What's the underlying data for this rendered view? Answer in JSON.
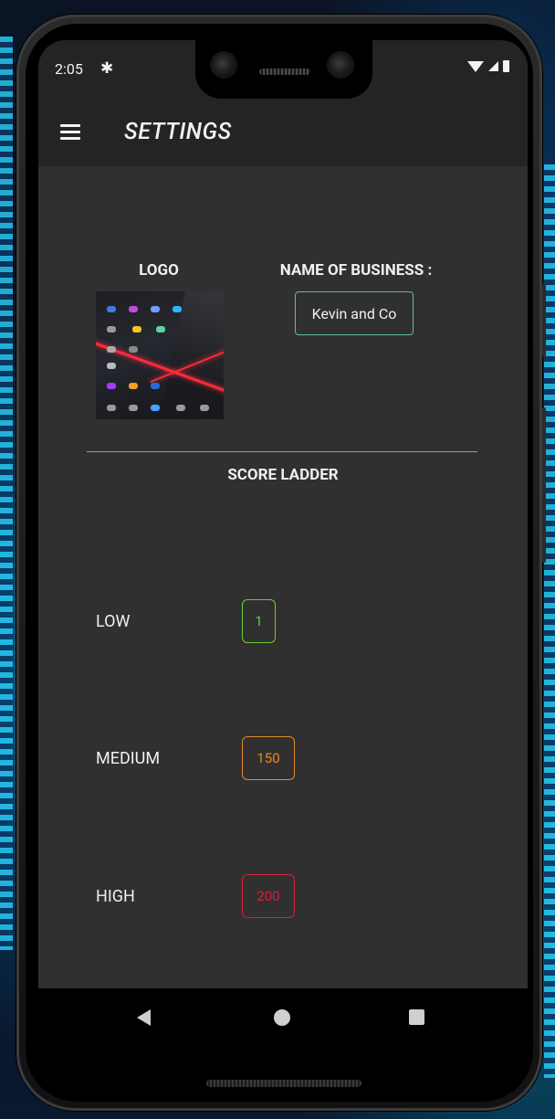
{
  "status_bar": {
    "time": "2:05",
    "settings_icon": "gear-icon",
    "wifi_icon": "wifi-icon",
    "signal_icon": "cell-signal-icon",
    "battery_icon": "battery-icon"
  },
  "app_bar": {
    "menu_icon": "hamburger-menu-icon",
    "title": "SETTINGS"
  },
  "logo_section": {
    "title": "LOGO"
  },
  "business": {
    "title": "NAME OF BUSINESS :",
    "value": "Kevin and Co"
  },
  "score_ladder": {
    "title": "SCORE LADDER",
    "levels": [
      {
        "label": "LOW",
        "value": "1",
        "color": "#6fce2e"
      },
      {
        "label": "MEDIUM",
        "value": "150",
        "color": "#e58a2a"
      },
      {
        "label": "HIGH",
        "value": "200",
        "color": "#d5203c"
      }
    ]
  },
  "colors": {
    "background": "#303030",
    "app_bar": "#242424",
    "accent": "#5fbf99",
    "text": "#f0f0f0"
  },
  "nav_bar": {
    "back_icon": "back-triangle-icon",
    "home_icon": "home-circle-icon",
    "recents_icon": "recents-square-icon"
  }
}
